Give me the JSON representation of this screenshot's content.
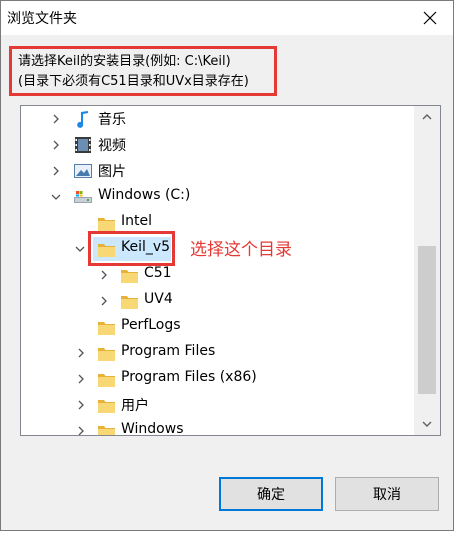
{
  "window": {
    "title": "浏览文件夹"
  },
  "description": {
    "line1": "请选择Keil的安装目录(例如: C:\\Keil)",
    "line2": "(目录下必须有C51目录和UVx目录存在)"
  },
  "tree": {
    "items": [
      {
        "label": "音乐",
        "icon": "music-note-icon",
        "expander": "collapsed"
      },
      {
        "label": "视频",
        "icon": "video-film-icon",
        "expander": "collapsed"
      },
      {
        "label": "图片",
        "icon": "picture-icon",
        "expander": "collapsed"
      },
      {
        "label": "Windows (C:)",
        "icon": "drive-icon",
        "expander": "expanded"
      },
      {
        "label": "Intel",
        "icon": "folder-icon",
        "expander": "none"
      },
      {
        "label": "Keil_v5",
        "icon": "folder-icon",
        "expander": "expanded",
        "selected": true
      },
      {
        "label": "C51",
        "icon": "folder-icon",
        "expander": "collapsed"
      },
      {
        "label": "UV4",
        "icon": "folder-icon",
        "expander": "collapsed"
      },
      {
        "label": "PerfLogs",
        "icon": "folder-icon",
        "expander": "none"
      },
      {
        "label": "Program Files",
        "icon": "folder-icon",
        "expander": "collapsed"
      },
      {
        "label": "Program Files (x86)",
        "icon": "folder-icon",
        "expander": "collapsed"
      },
      {
        "label": "用户",
        "icon": "folder-icon",
        "expander": "collapsed"
      },
      {
        "label": "Windows",
        "icon": "folder-icon",
        "expander": "collapsed"
      }
    ]
  },
  "annotation": {
    "text": "选择这个目录",
    "color": "#e53935"
  },
  "buttons": {
    "ok": "确定",
    "cancel": "取消"
  },
  "colors": {
    "highlight": "#e53935",
    "focus": "#0078d7",
    "folder": "#f5c542"
  }
}
